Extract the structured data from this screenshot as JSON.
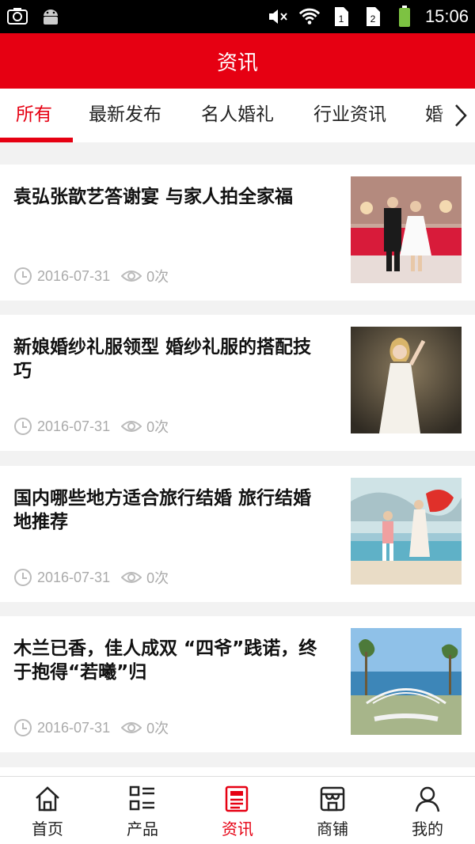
{
  "status_bar": {
    "time": "15:06",
    "icons": [
      "screenshot-icon",
      "android-icon",
      "mute-icon",
      "wifi-icon",
      "sim1-icon",
      "sim2-icon",
      "battery-icon"
    ]
  },
  "header": {
    "title": "资讯"
  },
  "tabs": [
    {
      "label": "所有",
      "active": true
    },
    {
      "label": "最新发布"
    },
    {
      "label": "名人婚礼"
    },
    {
      "label": "行业资讯"
    },
    {
      "label": "婚"
    }
  ],
  "news": [
    {
      "title": "袁弘张歆艺答谢宴 与家人拍全家福",
      "date": "2016-07-31",
      "views": "0次"
    },
    {
      "title": "新娘婚纱礼服领型 婚纱礼服的搭配技巧",
      "date": "2016-07-31",
      "views": "0次"
    },
    {
      "title": "国内哪些地方适合旅行结婚 旅行结婚地推荐",
      "date": "2016-07-31",
      "views": "0次"
    },
    {
      "title": "木兰已香，佳人成双 “四爷”践诺，终于抱得“若曦”归",
      "date": "2016-07-31",
      "views": "0次"
    }
  ],
  "bottom_nav": [
    {
      "label": "首页",
      "icon": "home-icon"
    },
    {
      "label": "产品",
      "icon": "grid-list-icon"
    },
    {
      "label": "资讯",
      "icon": "news-icon",
      "active": true
    },
    {
      "label": "商铺",
      "icon": "store-icon"
    },
    {
      "label": "我的",
      "icon": "user-icon"
    }
  ],
  "colors": {
    "accent": "#e60012",
    "meta": "#aaaaaa"
  }
}
